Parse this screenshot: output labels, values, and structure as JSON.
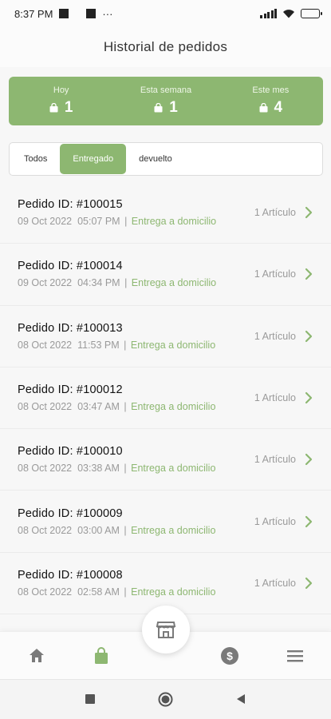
{
  "status_bar": {
    "time": "8:37 PM",
    "extra": "···"
  },
  "header": {
    "title": "Historial de pedidos"
  },
  "summary": [
    {
      "label": "Hoy",
      "value": "1"
    },
    {
      "label": "Esta semana",
      "value": "1"
    },
    {
      "label": "Este mes",
      "value": "4"
    }
  ],
  "tabs": [
    {
      "label": "Todos",
      "active": false
    },
    {
      "label": "Entregado",
      "active": true
    },
    {
      "label": "devuelto",
      "active": false
    }
  ],
  "orders": [
    {
      "id": "Pedido ID: #100015",
      "date": "09 Oct 2022",
      "time": "05:07 PM",
      "delivery": "Entrega a domicilio",
      "count": "1 Artículo"
    },
    {
      "id": "Pedido ID: #100014",
      "date": "09 Oct 2022",
      "time": "04:34 PM",
      "delivery": "Entrega a domicilio",
      "count": "1 Artículo"
    },
    {
      "id": "Pedido ID: #100013",
      "date": "08 Oct 2022",
      "time": "11:53 PM",
      "delivery": "Entrega a domicilio",
      "count": "1 Artículo"
    },
    {
      "id": "Pedido ID: #100012",
      "date": "08 Oct 2022",
      "time": "03:47 AM",
      "delivery": "Entrega a domicilio",
      "count": "1 Artículo"
    },
    {
      "id": "Pedido ID: #100010",
      "date": "08 Oct 2022",
      "time": "03:38 AM",
      "delivery": "Entrega a domicilio",
      "count": "1 Artículo"
    },
    {
      "id": "Pedido ID: #100009",
      "date": "08 Oct 2022",
      "time": "03:00 AM",
      "delivery": "Entrega a domicilio",
      "count": "1 Artículo"
    },
    {
      "id": "Pedido ID: #100008",
      "date": "08 Oct 2022",
      "time": "02:58 AM",
      "delivery": "Entrega a domicilio",
      "count": "1 Artículo"
    }
  ],
  "bottom_nav": {
    "items": [
      "home-icon",
      "shopping-bag-icon",
      "store-icon",
      "dollar-icon",
      "menu-icon"
    ],
    "active": "shopping-bag-icon"
  },
  "colors": {
    "accent": "#8db771",
    "muted_text": "#9a9a9a",
    "icon_gray": "#7a7a7a"
  }
}
